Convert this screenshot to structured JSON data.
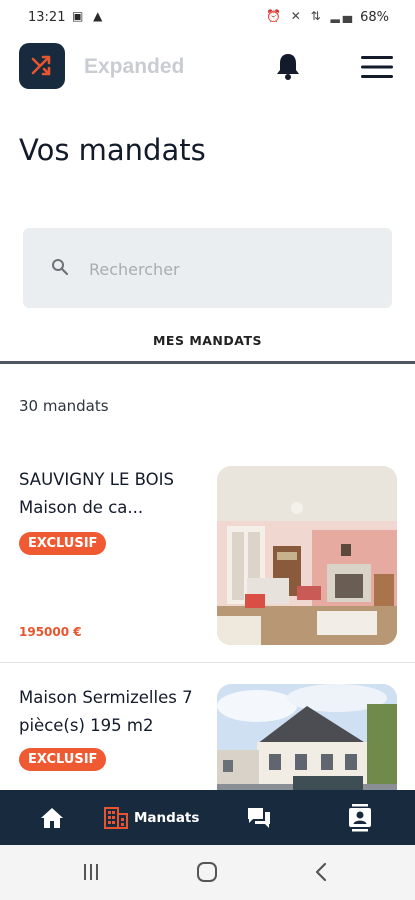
{
  "status_bar": {
    "time": "13:21",
    "left_icons": "▣ ▲",
    "right_icons": "⏰ ✕ ⇅ ▂▄",
    "battery": "68%"
  },
  "header": {
    "app_name": "Expanded",
    "logo_color": "#182b3e",
    "logo_accent": "#e8542d"
  },
  "page": {
    "title": "Vos mandats"
  },
  "search": {
    "placeholder": "Rechercher",
    "value": ""
  },
  "tabs": [
    {
      "label": "MES MANDATS",
      "active": true
    }
  ],
  "list": {
    "count_text": "30 mandats",
    "items": [
      {
        "title": "SAUVIGNY LE BOIS Maison de ca...",
        "badge": "EXCLUSIF",
        "price": "195000 €",
        "image": "living-room-photo"
      },
      {
        "title": "Maison Sermizelles 7 pièce(s) 195 m2",
        "badge": "EXCLUSIF",
        "price": "",
        "image": "house-exterior-photo"
      }
    ]
  },
  "bottom_nav": {
    "items": [
      {
        "icon": "home-icon",
        "label": ""
      },
      {
        "icon": "building-icon",
        "label": "Mandats",
        "active": true
      },
      {
        "icon": "chat-icon",
        "label": ""
      },
      {
        "icon": "contact-icon",
        "label": ""
      }
    ],
    "background": "#182b3e",
    "accent": "#e8542d"
  },
  "system_nav": {
    "icons": [
      "recents-icon",
      "home-circle-icon",
      "back-icon"
    ]
  }
}
